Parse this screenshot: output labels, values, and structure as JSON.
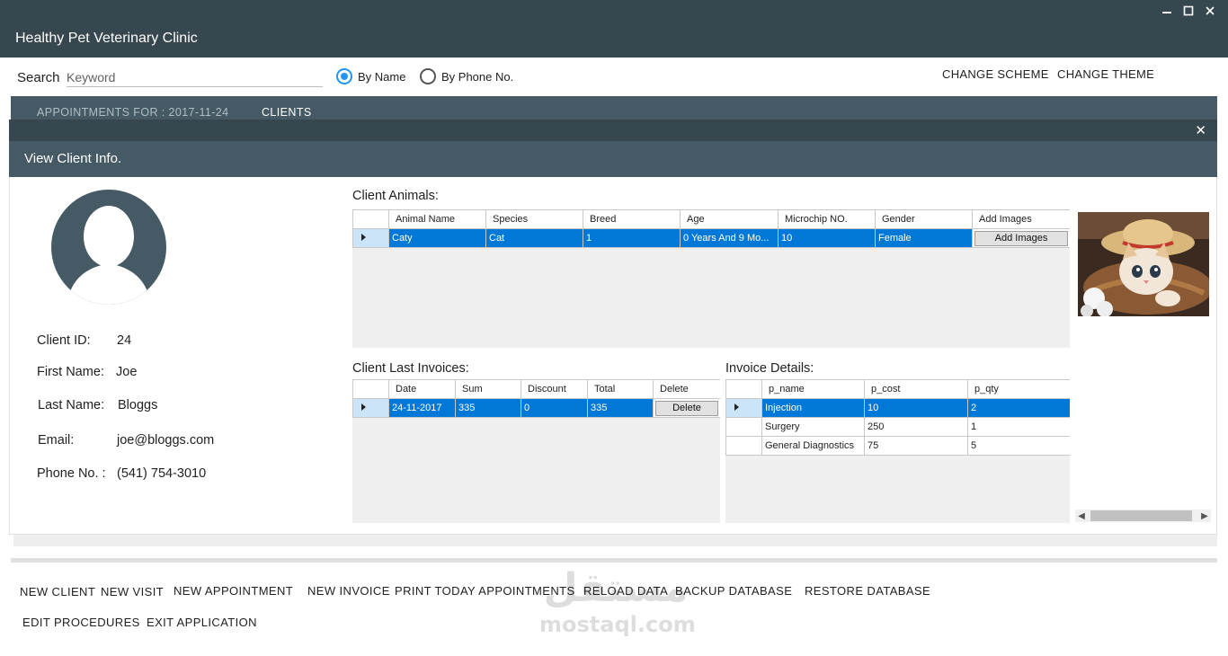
{
  "window": {
    "title": "Healthy Pet Veterinary Clinic",
    "controls": [
      "minimize-icon",
      "maximize-icon",
      "close-icon"
    ]
  },
  "search": {
    "label": "Search",
    "placeholder": "Keyword",
    "options": [
      {
        "label": "By Name",
        "checked": true
      },
      {
        "label": "By Phone No.",
        "checked": false
      }
    ]
  },
  "top_actions": {
    "change_scheme": "CHANGE SCHEME",
    "change_theme": "CHANGE THEME"
  },
  "tabs": [
    {
      "label": "APPOINTMENTS FOR : 2017-11-24",
      "active": false
    },
    {
      "label": "CLIENTS",
      "active": true
    }
  ],
  "dialog": {
    "title": "View Client Info.",
    "close_icon": "close-icon"
  },
  "client": {
    "id_label": "Client ID:",
    "id": "24",
    "first_name_label": "First Name:",
    "first_name": "Joe",
    "last_name_label": "Last Name:",
    "last_name": "Bloggs",
    "email_label": "Email:",
    "email": "joe@bloggs.com",
    "phone_label": "Phone No. :",
    "phone": "(541) 754-3010"
  },
  "animals": {
    "title": "Client Animals:",
    "columns": [
      "Animal Name",
      "Species",
      "Breed",
      "Age",
      "Microchip NO.",
      "Gender",
      "Add Images"
    ],
    "rows": [
      {
        "name": "Caty",
        "species": "Cat",
        "breed": "1",
        "age": "0 Years  And 9 Mo...",
        "microchip": "10",
        "gender": "Female",
        "button": "Add Images",
        "selected": true
      }
    ]
  },
  "invoices": {
    "title": "Client Last Invoices:",
    "columns": [
      "Date",
      "Sum",
      "Discount",
      "Total",
      "Delete"
    ],
    "rows": [
      {
        "date": "24-11-2017",
        "sum": "335",
        "discount": "0",
        "total": "335",
        "button": "Delete",
        "selected": true
      }
    ]
  },
  "invoice_details": {
    "title": "Invoice Details:",
    "columns": [
      "p_name",
      "p_cost",
      "p_qty"
    ],
    "rows": [
      {
        "name": "Injection",
        "cost": "10",
        "qty": "2",
        "selected": true
      },
      {
        "name": "Surgery",
        "cost": "250",
        "qty": "1",
        "selected": false
      },
      {
        "name": "General Diagnostics",
        "cost": "75",
        "qty": "5",
        "selected": false
      }
    ]
  },
  "bottom_actions": {
    "new_client": "NEW CLIENT",
    "new_visit": "NEW VISIT",
    "new_appointment": "NEW APPOINTMENT",
    "new_invoice": "NEW INVOICE",
    "print_today": "PRINT TODAY APPOINTMENTS",
    "reload_data": "RELOAD DATA",
    "backup_db": "BACKUP DATABASE",
    "restore_db": "RESTORE DATABASE",
    "edit_procedures": "EDIT PROCEDURES",
    "exit_app": "EXIT APPLICATION"
  },
  "watermark": {
    "text_ar": "مستقل",
    "text_en": "mostaql.com"
  },
  "colors": {
    "header": "#37474f",
    "subheader": "#455a64",
    "selection": "#0078d7",
    "accent": "#2196f3"
  }
}
